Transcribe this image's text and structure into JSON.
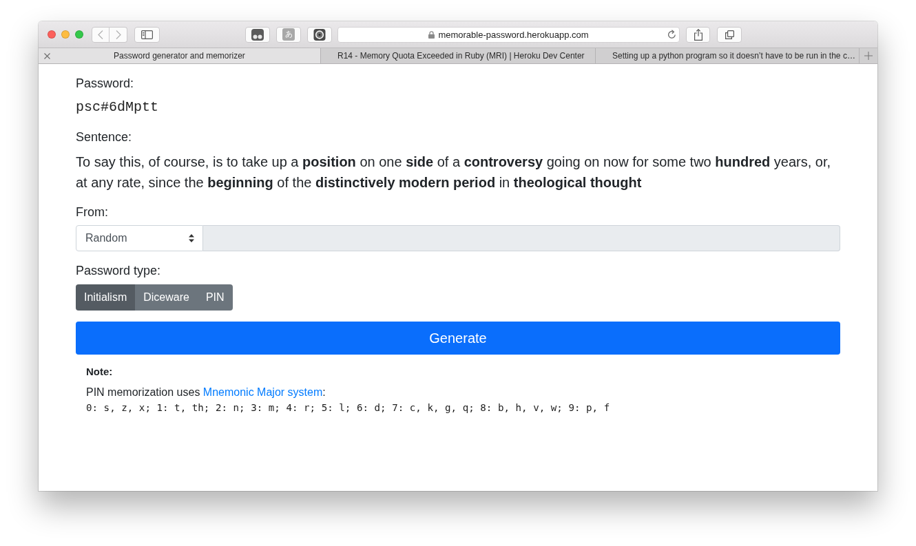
{
  "window": {
    "toolbar": {
      "extension_glyph": "あ",
      "address": "memorable-password.herokuapp.com"
    },
    "tabs": [
      {
        "label": "Password generator and memorizer",
        "selected": true
      },
      {
        "label": "R14 - Memory Quota Exceeded in Ruby (MRI) | Heroku Dev Center",
        "selected": false
      },
      {
        "label": "Setting up a python program so it doesn’t have to be run in the c…",
        "selected": false
      }
    ]
  },
  "page": {
    "password": {
      "label": "Password:",
      "value": "psc#6dMptt"
    },
    "sentence": {
      "label": "Sentence:",
      "text": "To say this, of course, is to take up a **position** on one **side** of a **controversy** going on now for some two **hundred** years, or, at any rate, since the **beginning** of the **distinctively modern period** in **theological thought**"
    },
    "source": {
      "label": "From:",
      "select": {
        "value": "Random"
      },
      "input": {
        "disabled": true
      }
    },
    "password_type": {
      "label": "Password type:",
      "options": [
        {
          "label": "Initialism",
          "selected": true
        },
        {
          "label": "Diceware",
          "selected": false
        },
        {
          "label": "PIN",
          "selected": false
        }
      ]
    },
    "generate_button": "Generate",
    "note": {
      "title": "Note:",
      "text": "PIN memorization uses",
      "link": "Mnemonic Major system",
      "text_end": ":",
      "mapping": "0: s, z, x; 1: t, th; 2: n; 3: m; 4: r; 5: l; 6: d; 7: c, k, g, q; 8: b, h, v, w; 9: p, f"
    }
  }
}
